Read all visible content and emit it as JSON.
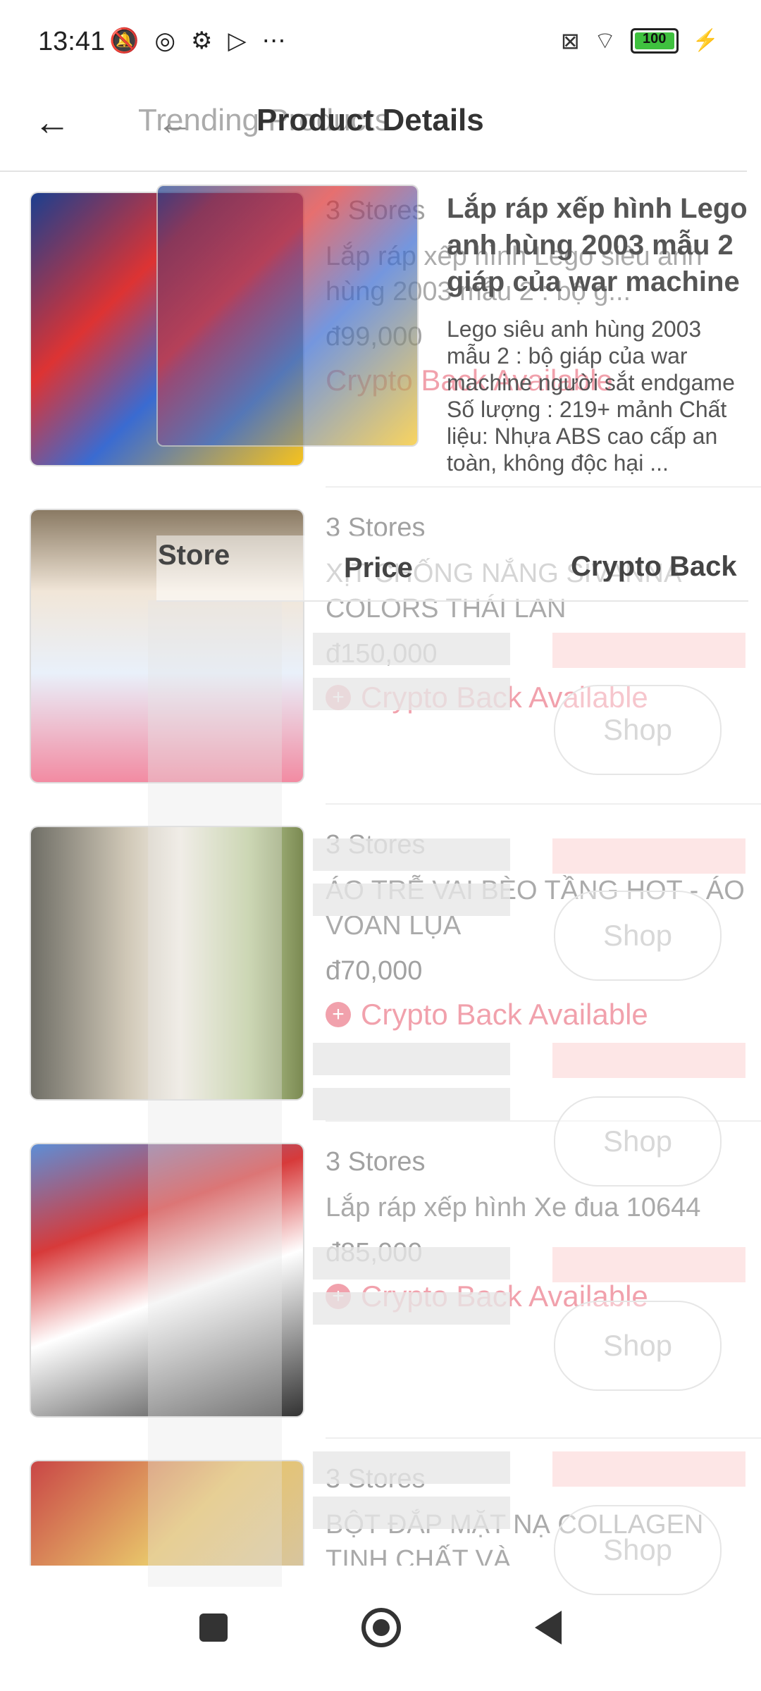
{
  "status": {
    "time": "13:41",
    "left_icons": [
      "bell-off-icon",
      "clipboard-icon",
      "gear-icon",
      "play-icon",
      "more-icon"
    ],
    "battery": "100"
  },
  "header": {
    "bg_title": "Trending Products",
    "fg_title": "Product Details"
  },
  "overlay": {
    "title": "Lắp ráp xếp hình Lego anh hùng 2003 mẫu 2 giáp của war machine",
    "description": "Lego siêu anh hùng 2003 mẫu 2 : bộ giáp của war machine người sắt endgame Số lượng : 219+ mảnh Chất liệu: Nhựa ABS cao cấp an toàn, không độc hại ...",
    "columns": [
      "Store",
      "Price",
      "Crypto Back"
    ],
    "shop_label": "Shop"
  },
  "list": {
    "crypto_label": "Crypto Back Available",
    "items": [
      {
        "stores": "3 Stores",
        "name": "Lắp ráp xếp hình Lego siêu anh hùng 2003 mẫu 2 : bộ g...",
        "price": "đ99,000"
      },
      {
        "stores": "3 Stores",
        "name": "XỊT CHỐNG NẮNG SIVANNA COLORS THÁI LAN",
        "price": "đ150,000"
      },
      {
        "stores": "3 Stores",
        "name": "ÁO TRỄ VAI BÈO TẦNG HOT - ÁO VOAN LỤA",
        "price": "đ70,000"
      },
      {
        "stores": "3 Stores",
        "name": "Lắp ráp xếp hình Xe đua 10644",
        "price": "đ85,000"
      },
      {
        "stores": "3 Stores",
        "name": "BỘT ĐẮP MẶT NẠ COLLAGEN TINH CHẤT VÀ",
        "price": ""
      }
    ]
  },
  "colors": {
    "accent": "#e7556a",
    "divider": "#e3e3e3",
    "battery": "#3fc13f"
  }
}
